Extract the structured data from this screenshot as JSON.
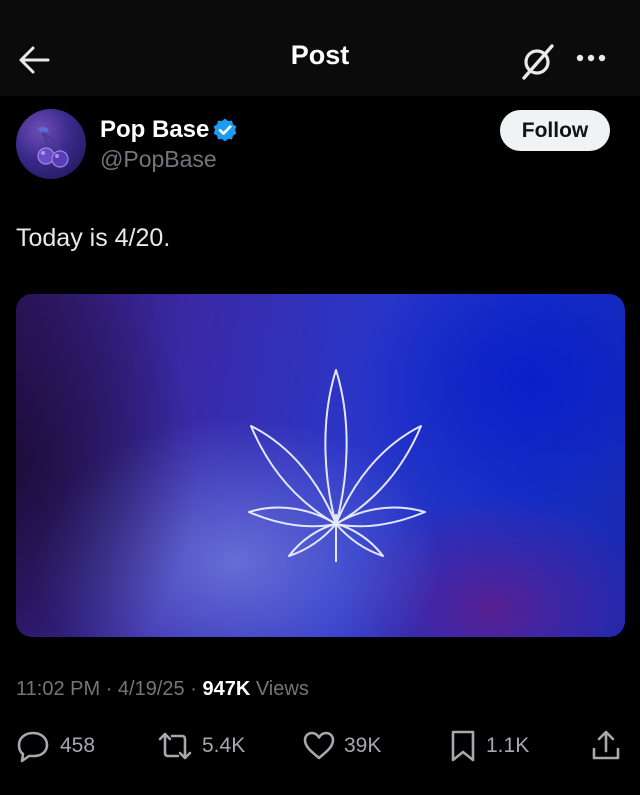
{
  "header": {
    "title": "Post",
    "back_icon": "arrow-left-icon",
    "grok_icon": "grok-icon",
    "more_icon": "more-horizontal-icon"
  },
  "author": {
    "name": "Pop Base",
    "handle": "@PopBase",
    "verified": true,
    "verified_color": "#1d9bf0",
    "avatar_icon": "cherries-icon",
    "follow_label": "Follow"
  },
  "post": {
    "text": "Today is 4/20.",
    "media_icon": "cannabis-leaf-icon",
    "time": "11:02 PM",
    "date": "4/19/25",
    "separator": "·",
    "views_count": "947K",
    "views_label": "Views"
  },
  "actions": {
    "replies": "458",
    "reposts": "5.4K",
    "likes": "39K",
    "bookmarks": "1.1K"
  }
}
